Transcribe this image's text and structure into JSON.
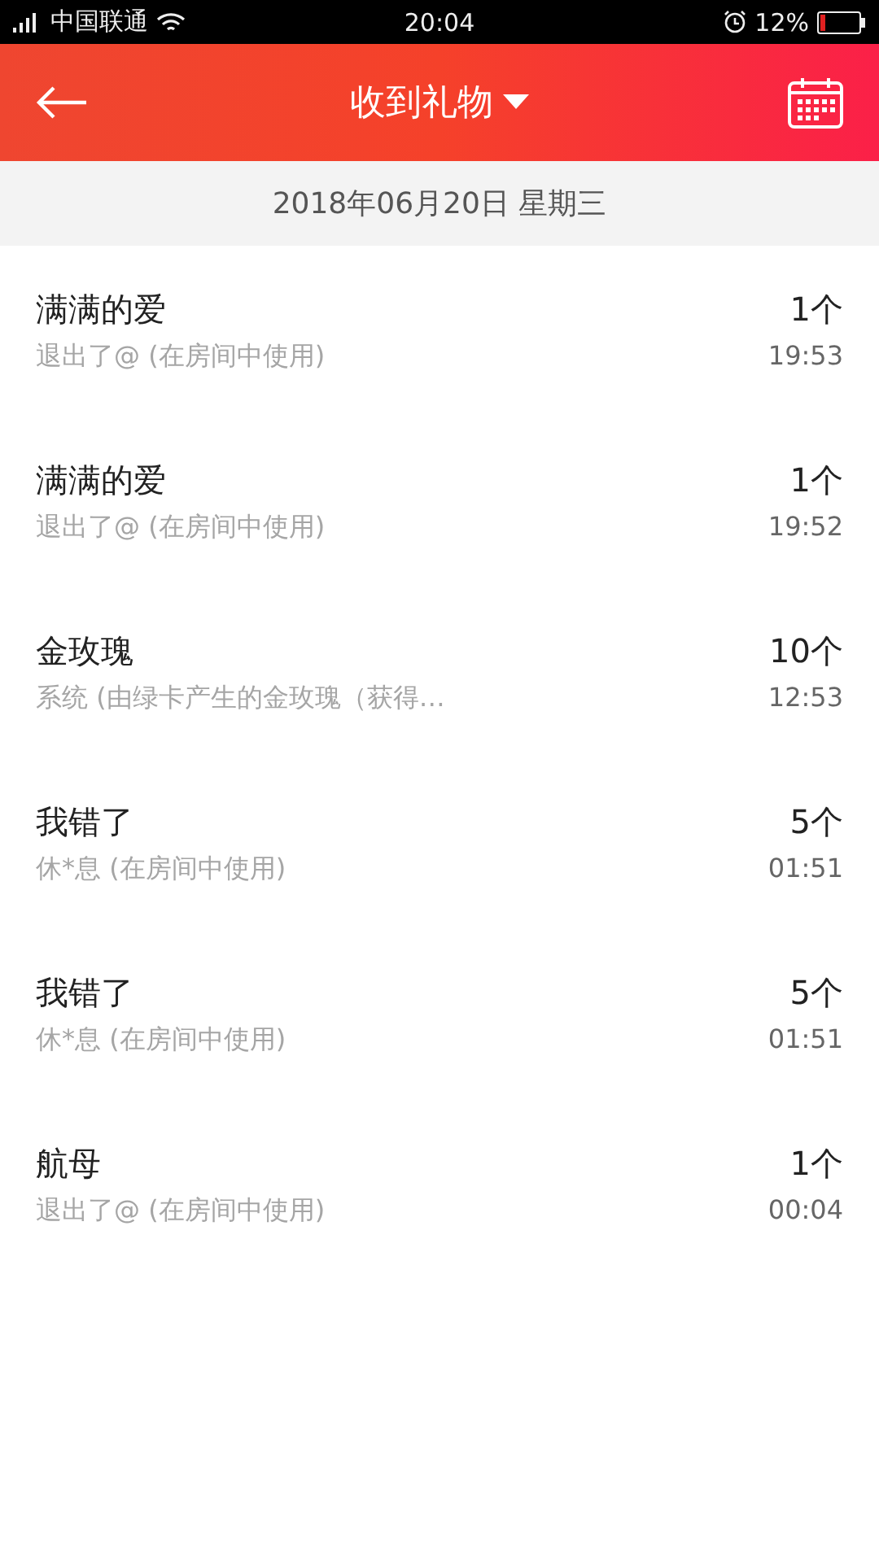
{
  "status_bar": {
    "carrier": "中国联通",
    "time": "20:04",
    "battery": "12%"
  },
  "header": {
    "title": "收到礼物"
  },
  "date": "2018年06月20日 星期三",
  "gifts": [
    {
      "name": "满满的爱",
      "source": "退出了@ (在房间中使用)",
      "count": "1个",
      "time": "19:53"
    },
    {
      "name": "满满的爱",
      "source": "退出了@ (在房间中使用)",
      "count": "1个",
      "time": "19:52"
    },
    {
      "name": "金玫瑰",
      "source": "系统 (由绿卡产生的金玫瑰（获得…",
      "count": "10个",
      "time": "12:53"
    },
    {
      "name": "我错了",
      "source": "休*息 (在房间中使用)",
      "count": "5个",
      "time": "01:51"
    },
    {
      "name": "我错了",
      "source": "休*息 (在房间中使用)",
      "count": "5个",
      "time": "01:51"
    },
    {
      "name": "航母",
      "source": "退出了@ (在房间中使用)",
      "count": "1个",
      "time": "00:04"
    }
  ]
}
